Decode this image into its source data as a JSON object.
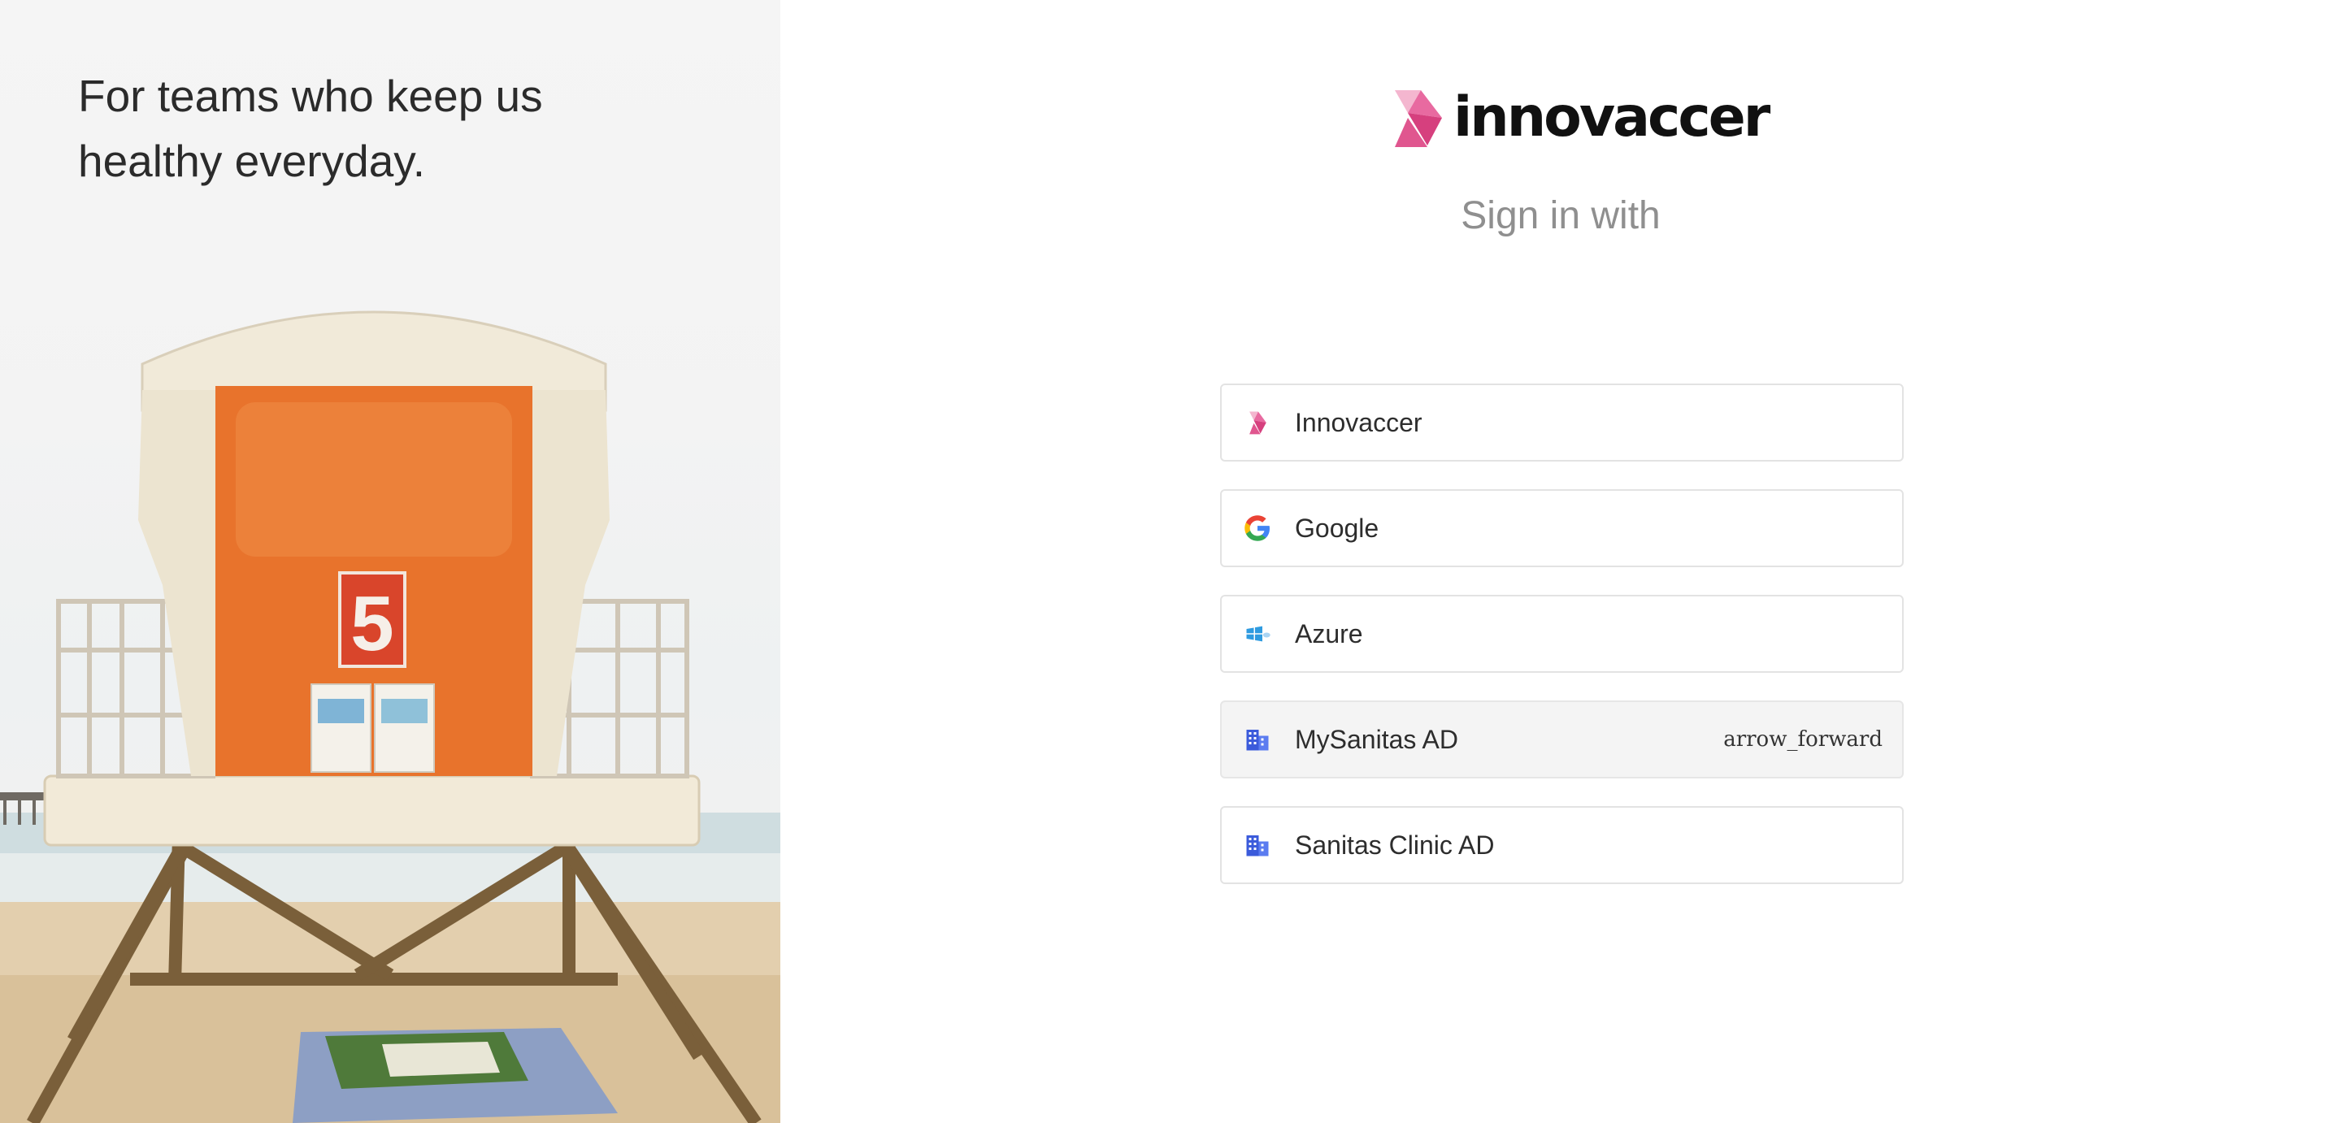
{
  "hero": {
    "tagline_line1": "For teams who keep us",
    "tagline_line2": "healthy everyday.",
    "tower_number": "5"
  },
  "brand": {
    "name": "innovaccer",
    "colors": {
      "pink_light": "#f4b6cf",
      "pink": "#e86aa0",
      "pink_dark": "#d6407e"
    }
  },
  "signin": {
    "title": "Sign in with",
    "providers": [
      {
        "label": "Innovaccer",
        "icon": "innovaccer-logo-icon"
      },
      {
        "label": "Google",
        "icon": "google-icon"
      },
      {
        "label": "Azure",
        "icon": "windows-cloud-icon"
      },
      {
        "label": "MySanitas AD",
        "icon": "building-icon",
        "hovered": true,
        "arrow": "arrow_forward"
      },
      {
        "label": "Sanitas Clinic AD",
        "icon": "building-icon"
      }
    ]
  },
  "colors": {
    "border": "#e3e3e3",
    "hover_bg": "#f4f4f4",
    "title_gray": "#8f8f8f",
    "tower_orange": "#e8732c",
    "building_blue": "#3b5bdb"
  }
}
